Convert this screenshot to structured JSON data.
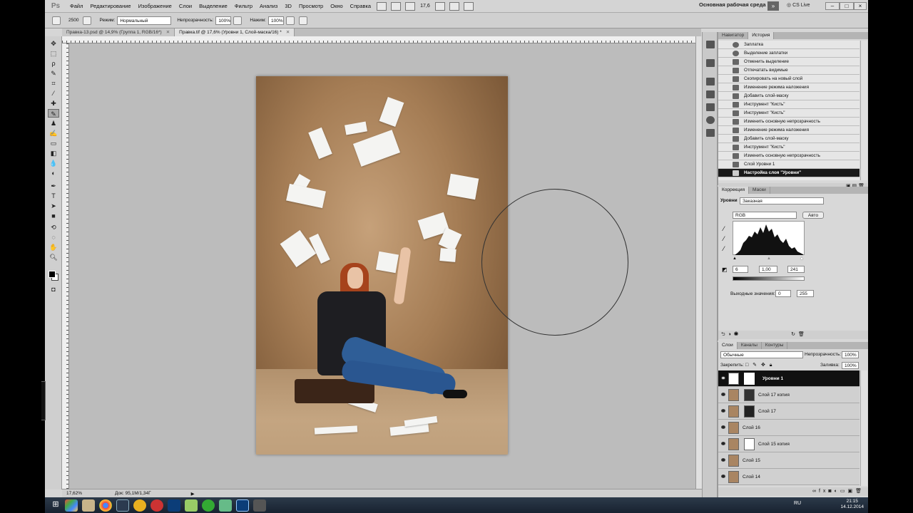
{
  "app": {
    "logo": "Ps"
  },
  "menu": [
    "Файл",
    "Редактирование",
    "Изображение",
    "Слои",
    "Выделение",
    "Фильтр",
    "Анализ",
    "3D",
    "Просмотр",
    "Окно",
    "Справка"
  ],
  "menubar_right": {
    "zoom": "17,6",
    "workspace": "Основная рабочая среда",
    "cslive": "CS Live"
  },
  "options": {
    "brush_size": "2500",
    "mode_label": "Режим:",
    "mode_value": "Нормальный",
    "opacity_label": "Непрозрачность:",
    "opacity_value": "100%",
    "pressure_label": "Нажим:",
    "pressure_value": "100%"
  },
  "doc_tabs": [
    {
      "label": "Правка-13.psd @ 14,9% (Группа 1, RGB/16*)",
      "active": false
    },
    {
      "label": "Правка.tif @ 17,6% (Уровни 1, Слой-маска/16) *",
      "active": true
    }
  ],
  "status": {
    "zoom": "17,62%",
    "doc": "Док: 95,1M/1,34Г"
  },
  "history": {
    "tabs": [
      "Навигатор",
      "История"
    ],
    "items": [
      "Заплатка",
      "Выделение заплатки",
      "Отменить выделение",
      "Отпечатать видимые",
      "Скопировать на новый слой",
      "Изменение режима наложения",
      "Добавить слой-маску",
      "Инструмент \"Кисть\"",
      "Инструмент \"Кисть\"",
      "Изменить основную непрозрачность",
      "Изменение режима наложения",
      "Добавить слой-маску",
      "Инструмент \"Кисть\"",
      "Изменить основную непрозрачность",
      "Слой Уровни 1",
      "Настройка слоя \"Уровни\""
    ],
    "selected_index": 15
  },
  "adjustments": {
    "tabs": [
      "Коррекция",
      "Маски"
    ],
    "preset_label": "Уровни",
    "preset_value": "Заказная",
    "channel": "RGB",
    "auto_label": "Авто",
    "input_black": "6",
    "input_gamma": "1,00",
    "input_white": "241",
    "output_label": "Выходные значения:",
    "output_black": "0",
    "output_white": "255"
  },
  "layers": {
    "tabs": [
      "Слои",
      "Каналы",
      "Контуры"
    ],
    "blend_mode": "Обычные",
    "opacity_label": "Непрозрачность:",
    "opacity_value": "100%",
    "lock_label": "Закрепить:",
    "fill_label": "Заливка:",
    "fill_value": "100%",
    "items": [
      {
        "name": "Уровни 1",
        "selected": true
      },
      {
        "name": "Слой 17 копия",
        "selected": false
      },
      {
        "name": "Слой 17",
        "selected": false
      },
      {
        "name": "Слой 16",
        "selected": false
      },
      {
        "name": "Слой 15 копия",
        "selected": false
      },
      {
        "name": "Слой 15",
        "selected": false
      },
      {
        "name": "Слой 14",
        "selected": false
      }
    ]
  },
  "taskbar": {
    "lang": "RU",
    "time": "21:15",
    "date": "14.12.2014"
  },
  "colors": {
    "selection": "#111111",
    "canvas_bg": "#bcbcbc",
    "accent": "#1a1a1a"
  }
}
